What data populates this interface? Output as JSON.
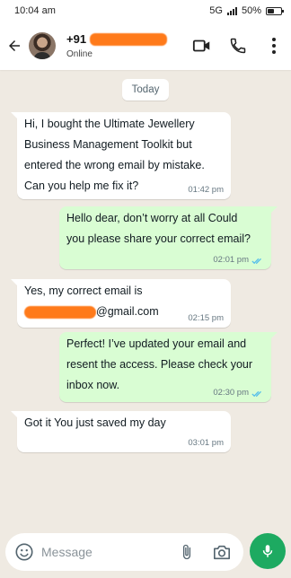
{
  "status_bar": {
    "time": "10:04 am",
    "network": "5G",
    "battery": "50%",
    "battery_level": 0.5
  },
  "header": {
    "contact_prefix": "+91",
    "contact_name_redacted": true,
    "status": "Online",
    "icons": [
      "back-arrow-icon",
      "video-call-icon",
      "phone-icon",
      "more-vertical-icon"
    ]
  },
  "chat": {
    "date_label": "Today",
    "messages": [
      {
        "direction": "incoming",
        "lines": [
          "Hi, I bought the Ultimate Jewellery",
          "Business Management Toolkit but",
          "entered the wrong email by mistake.",
          "Can you help me fix it?"
        ],
        "time": "01:42 pm"
      },
      {
        "direction": "outgoing",
        "lines": [
          "Hello dear, don’t worry at all Could",
          "you please share your correct email?"
        ],
        "time": "02:01 pm",
        "read": true
      },
      {
        "direction": "incoming",
        "lines": [
          "Yes, my correct email is",
          "@gmail.com"
        ],
        "time": "02:15 pm"
      },
      {
        "direction": "outgoing",
        "lines": [
          "Perfect! I’ve updated your email and",
          "resent the access. Please check your",
          "inbox now."
        ],
        "time": "02:30 pm",
        "read": true
      },
      {
        "direction": "incoming",
        "lines": [
          "Got it You just saved my day"
        ],
        "time": "03:01 pm"
      }
    ]
  },
  "input": {
    "placeholder": "Message"
  },
  "colors": {
    "chat_background": "#efeae2",
    "incoming_bubble": "#ffffff",
    "outgoing_bubble": "#d9fdd3",
    "read_ticks": "#53bdeb",
    "mic_button": "#1daa61",
    "redaction": "#ff7a1a"
  }
}
